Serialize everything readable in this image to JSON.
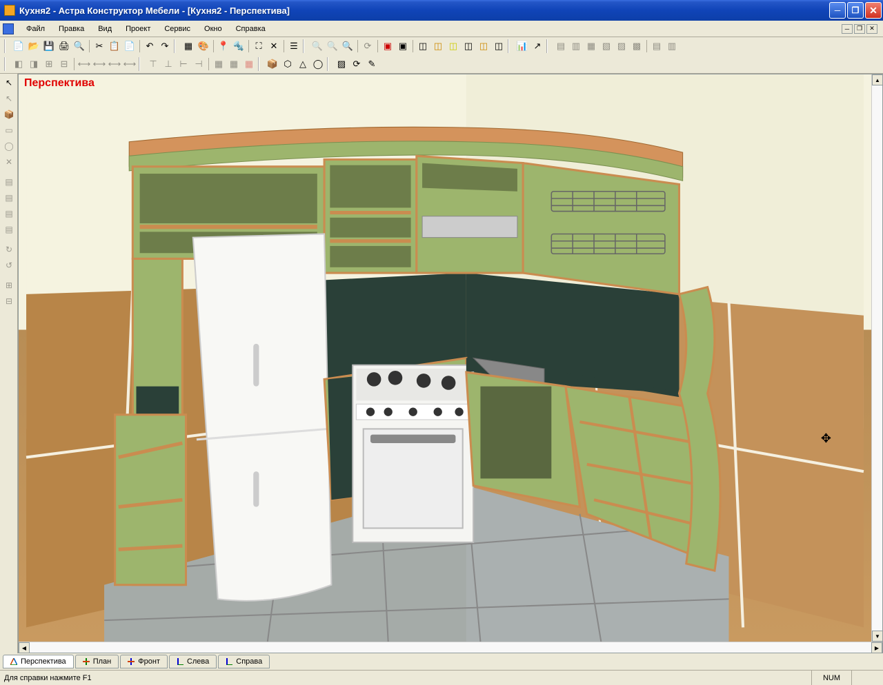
{
  "window": {
    "title": "Кухня2 - Астра Конструктор Мебели - [Кухня2 - Перспектива]"
  },
  "menu": {
    "items": [
      "Файл",
      "Правка",
      "Вид",
      "Проект",
      "Сервис",
      "Окно",
      "Справка"
    ]
  },
  "viewport": {
    "label": "Перспектива"
  },
  "view_tabs": [
    {
      "label": "Перспектива",
      "active": true,
      "color": "#d04000"
    },
    {
      "label": "План",
      "active": false,
      "color": "#008000"
    },
    {
      "label": "Фронт",
      "active": false,
      "color": "#0000d0"
    },
    {
      "label": "Слева",
      "active": false,
      "color": "#006060"
    },
    {
      "label": "Справа",
      "active": false,
      "color": "#606000"
    }
  ],
  "statusbar": {
    "help": "Для справки нажмите F1",
    "num": "NUM"
  }
}
